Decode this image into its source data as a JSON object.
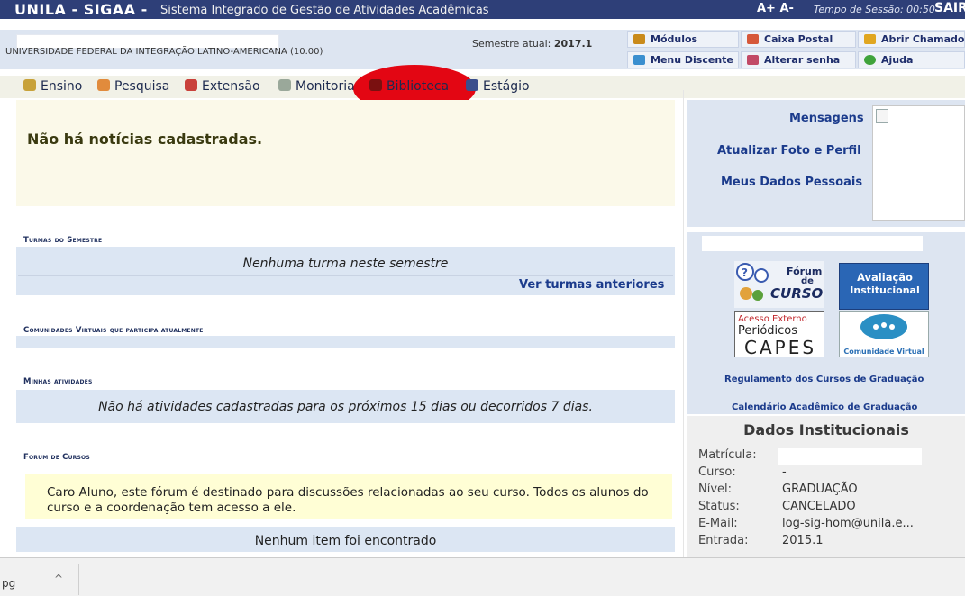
{
  "topbar": {
    "title": "UNILA - SIGAA -",
    "subtitle": "Sistema Integrado de Gestão de Atividades Acadêmicas",
    "font_size_controls": "A+ A-",
    "session_time": "Tempo de Sessão: 00:50",
    "logout": "SAIR"
  },
  "infobar": {
    "university": "UNIVERSIDADE FEDERAL DA INTEGRAÇÃO LATINO-AMERICANA (10.00)",
    "semester_label": "Semestre atual:",
    "semester_value": "2017.1",
    "buttons": {
      "modulos": "Módulos",
      "caixa_postal": "Caixa Postal",
      "abrir_chamado": "Abrir Chamado",
      "menu_discente": "Menu Discente",
      "alterar_senha": "Alterar senha",
      "ajuda": "Ajuda"
    }
  },
  "menu": {
    "items": [
      "Ensino",
      "Pesquisa",
      "Extensão",
      "Monitoria",
      "Biblioteca",
      "Estágio"
    ]
  },
  "news": {
    "empty": "Não há notícias cadastradas."
  },
  "turmas": {
    "title": "Turmas do Semestre",
    "empty": "Nenhuma turma neste semestre",
    "link": "Ver turmas anteriores"
  },
  "comunidades": {
    "title": "Comunidades Virtuais que participa atualmente"
  },
  "atividades": {
    "title": "Minhas atividades",
    "empty": "Não há atividades cadastradas para os próximos 15 dias ou decorridos 7 dias."
  },
  "forum": {
    "title": "Forum de Cursos",
    "message": "Caro Aluno, este fórum é destinado para discussões relacionadas ao seu curso. Todos os alunos do curso e a coordenação tem acesso a ele.",
    "empty": "Nenhum item foi encontrado"
  },
  "sidebar": {
    "mensagens": "Mensagens",
    "atualizar_foto": "Atualizar Foto e Perfil",
    "meus_dados": "Meus Dados Pessoais",
    "promos": {
      "forum": [
        "Fórum",
        "de",
        "CURSO"
      ],
      "avaliacao": [
        "Avaliação",
        "Institucional"
      ],
      "capes": [
        "Acesso Externo",
        "Periódicos",
        "CAPES"
      ],
      "comunidade": "Comunidade Virtual"
    },
    "regulamento": "Regulamento dos Cursos de Graduação",
    "calendario": "Calendário Acadêmico de Graduação"
  },
  "dados": {
    "title": "Dados Institucionais",
    "rows": [
      {
        "label": "Matrícula:",
        "value": ""
      },
      {
        "label": "Curso:",
        "value": "-"
      },
      {
        "label": "Nível:",
        "value": "GRADUAÇÃO"
      },
      {
        "label": "Status:",
        "value": "CANCELADO"
      },
      {
        "label": "E-Mail:",
        "value": "log-sig-hom@unila.e..."
      },
      {
        "label": "Entrada:",
        "value": "2015.1"
      }
    ]
  },
  "downloads": {
    "file_suffix": "pg",
    "chevron": "^"
  },
  "colors": {
    "topbar_bg": "#2e3f78",
    "highlight": "#e30613",
    "link": "#1b3b8c",
    "band": "#dce6f3"
  }
}
